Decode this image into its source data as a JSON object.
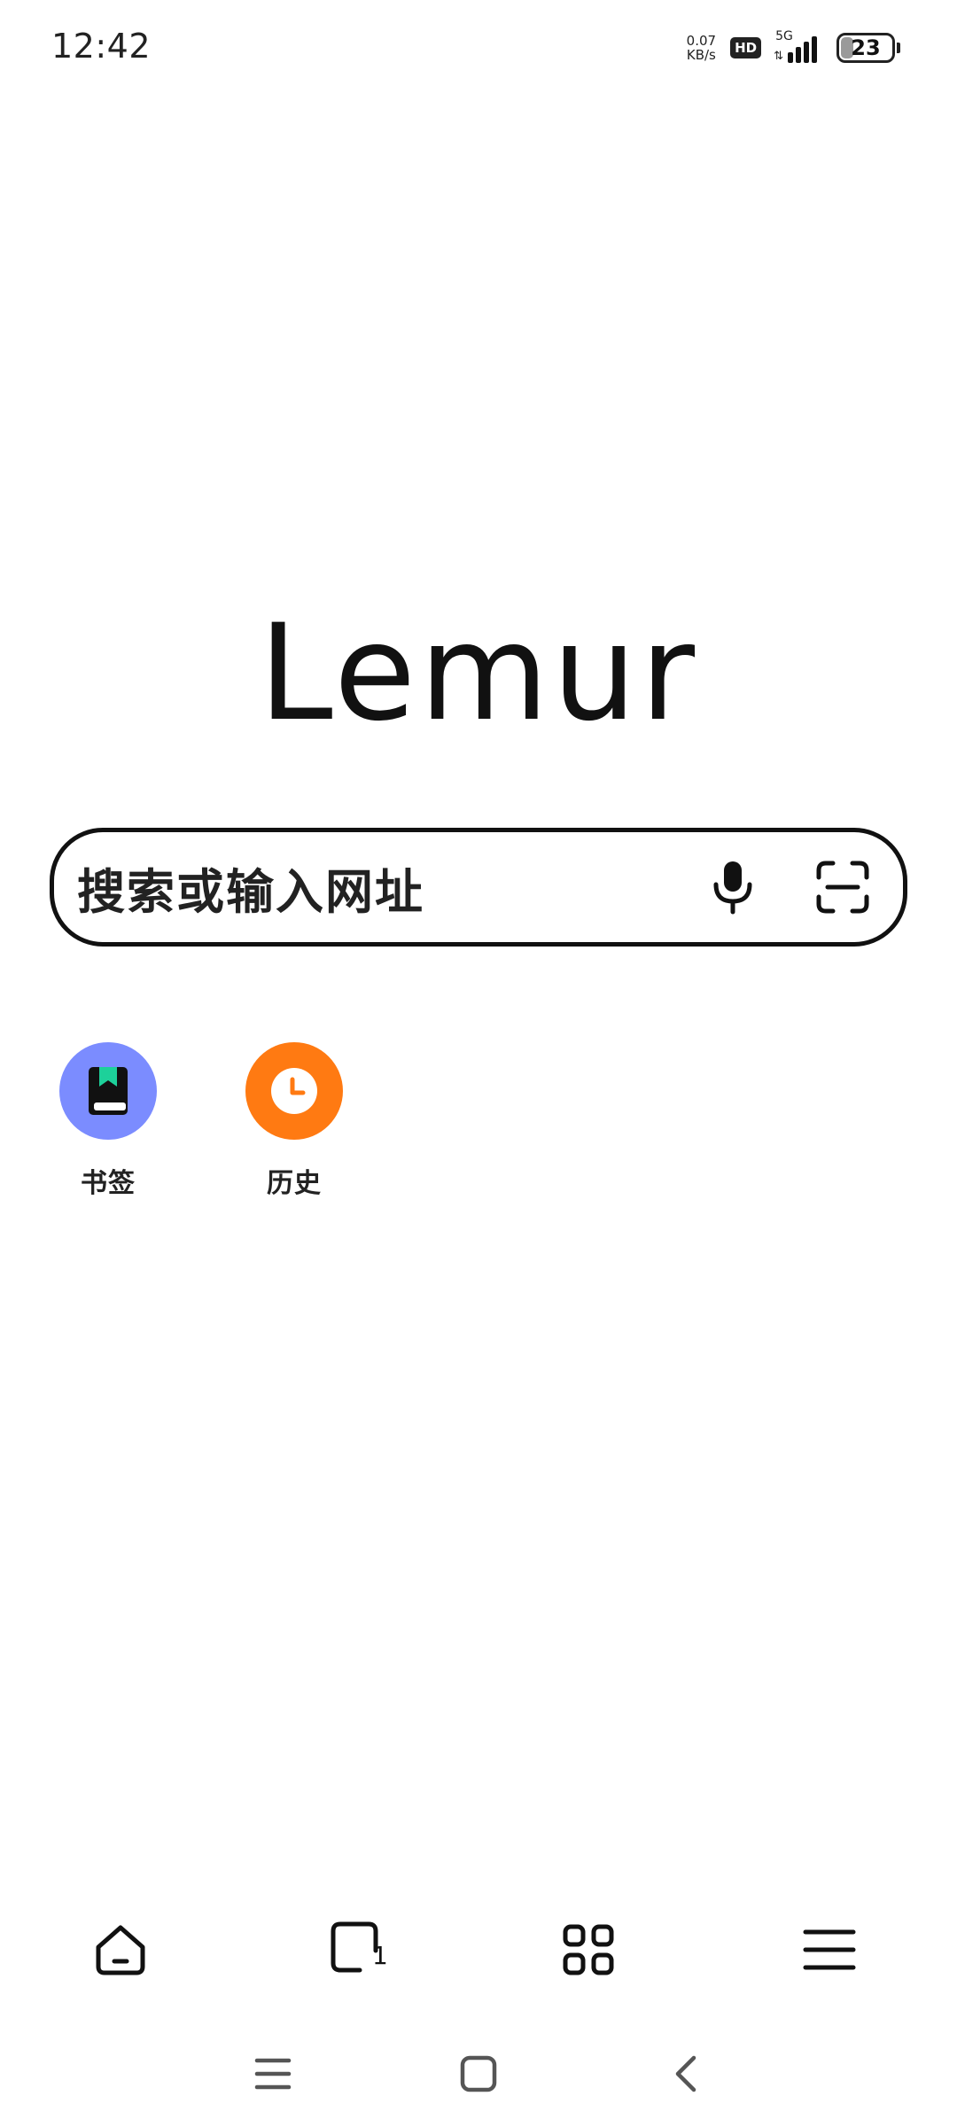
{
  "status_bar": {
    "time": "12:42",
    "net_speed_value": "0.07",
    "net_speed_unit": "KB/s",
    "hd_label": "HD",
    "network_label": "5G",
    "battery_level": "23",
    "icons": [
      "hd-icon",
      "signal-icon",
      "battery-icon"
    ]
  },
  "app": {
    "logo_text": "Lemur"
  },
  "search": {
    "placeholder": "搜索或输入网址",
    "icons": [
      "microphone-icon",
      "scan-icon"
    ]
  },
  "shortcuts": [
    {
      "label": "书签",
      "icon": "bookmark-icon",
      "color": "#7B8CFF"
    },
    {
      "label": "历史",
      "icon": "clock-icon",
      "color": "#FF7A12"
    }
  ],
  "toolbar": {
    "tab_count": "1",
    "icons": [
      "home-icon",
      "tabs-icon",
      "apps-icon",
      "menu-icon"
    ]
  },
  "system_nav": {
    "icons": [
      "recents-icon",
      "home-nav-icon",
      "back-icon"
    ]
  },
  "colors": {
    "text": "#111111",
    "bookmark_accent": "#1DD19A",
    "background": "#FFFFFF"
  }
}
